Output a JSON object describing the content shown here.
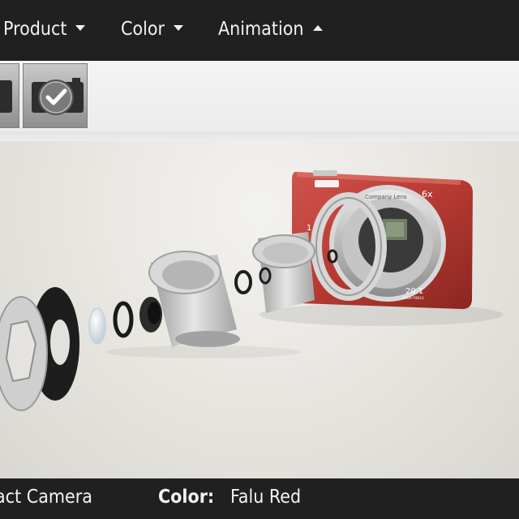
{
  "menu": {
    "product": "Product",
    "color": "Color",
    "animation": "Animation"
  },
  "icons": {
    "menu_closed": "caret-down-icon",
    "menu_open": "caret-up-icon",
    "selected_thumb": "checkmark-icon"
  },
  "viewport": {
    "lens_text": "Company Lens",
    "zoom_text": "6x",
    "megapixel_text": "20.1",
    "megapixel_unit": "MEGA PIXELS",
    "camera_color": "#b63a32"
  },
  "info": {
    "product_name": "act Camera",
    "color_label": "Color:",
    "color_value": "Falu Red"
  }
}
